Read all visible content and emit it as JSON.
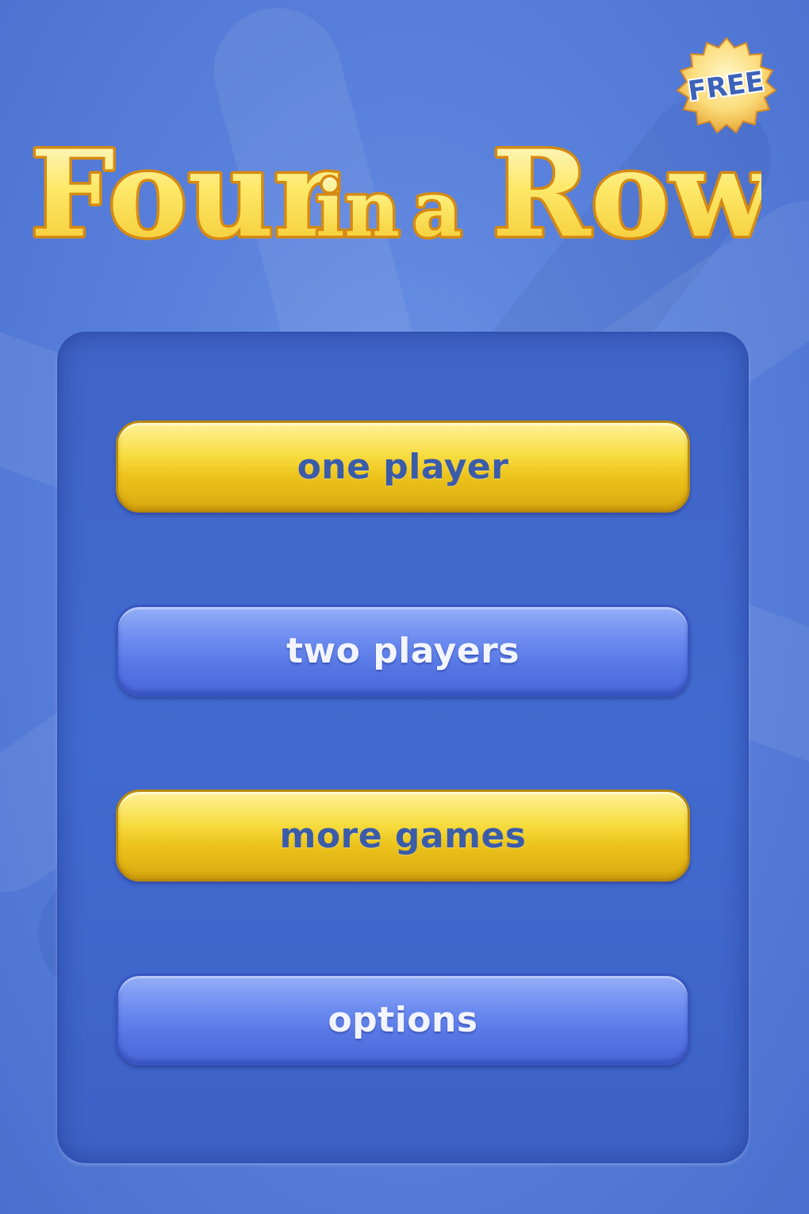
{
  "title": {
    "text": "Four in a Row",
    "words": [
      "Four",
      "in",
      "a",
      "Row"
    ]
  },
  "badge": {
    "label": "FREE"
  },
  "menu": {
    "buttons": [
      {
        "label": "one player",
        "style": "yellow"
      },
      {
        "label": "two players",
        "style": "blue"
      },
      {
        "label": "more games",
        "style": "yellow"
      },
      {
        "label": "options",
        "style": "blue"
      }
    ]
  },
  "colors": {
    "background": "#5a82dc",
    "panel": "#416ad0",
    "title_fill": "#fde96a",
    "title_outline": "#d68a12",
    "button_yellow": "#f7dc3e",
    "button_blue": "#6f8ef0",
    "yellow_button_text": "#3b5ca8",
    "blue_button_text": "#f2f5ff"
  }
}
